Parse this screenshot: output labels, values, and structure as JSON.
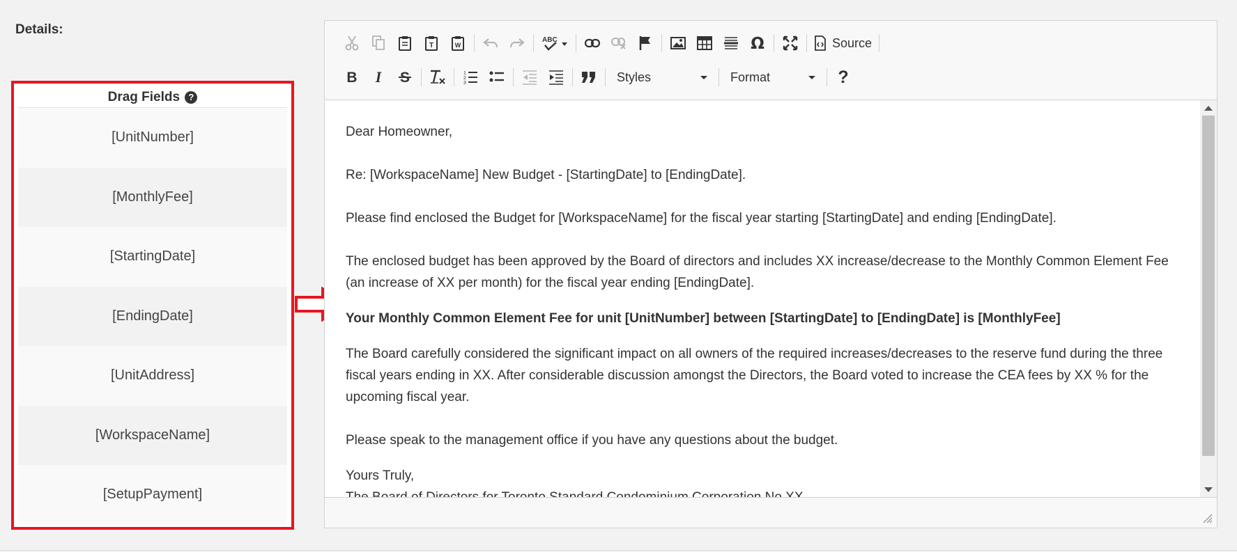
{
  "details_label": "Details:",
  "drag_fields": {
    "header": "Drag Fields",
    "help_glyph": "?",
    "items": [
      {
        "label": "[UnitNumber]"
      },
      {
        "label": "[MonthlyFee]"
      },
      {
        "label": "[StartingDate]"
      },
      {
        "label": "[EndingDate]"
      },
      {
        "label": "[UnitAddress]"
      },
      {
        "label": "[WorkspaceName]"
      },
      {
        "label": "[SetupPayment]"
      }
    ]
  },
  "toolbar": {
    "source_label": "Source",
    "styles_label": "Styles",
    "format_label": "Format",
    "help_glyph": "?"
  },
  "content": {
    "greeting": "Dear Homeowner,",
    "re_line": "Re: [WorkspaceName] New Budget - [StartingDate] to [EndingDate].",
    "para1": "Please find enclosed the Budget for [WorkspaceName] for the fiscal year starting [StartingDate] and ending [EndingDate].",
    "para2": "The enclosed budget has been approved by the Board of directors and includes XX increase/decrease to the Monthly Common Element Fee (an increase of XX per month) for the fiscal year ending [EndingDate].",
    "bold_line": "Your Monthly Common Element Fee for unit [UnitNumber] between [StartingDate] to [EndingDate] is [MonthlyFee]",
    "para3": "The Board carefully considered the significant impact on all owners of the required increases/decreases to the reserve fund during the three fiscal years ending in XX. After considerable discussion amongst the Directors, the Board voted to increase the CEA fees by XX % for the upcoming fiscal year.",
    "para4": "Please speak to the management office if you have any questions about the budget.",
    "closing": "Yours Truly,",
    "signature": "The Board of Directors for Toronto Standard Condominium Corporation No XX"
  },
  "colors": {
    "highlight_border": "#e8161f",
    "icon_dark": "#333333",
    "icon_disabled": "#b5b5b5"
  }
}
